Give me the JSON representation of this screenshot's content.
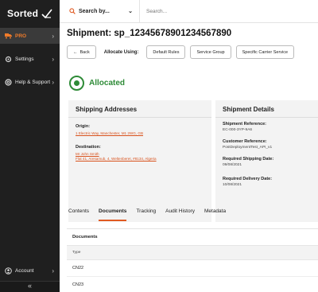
{
  "sidebar": {
    "brand": "Sorted",
    "items": [
      {
        "label": "PRO"
      },
      {
        "label": "Settings"
      },
      {
        "label": "Help & Support"
      }
    ],
    "account_label": "Account",
    "collapse_glyph": "«",
    "accent": "#f07b2a"
  },
  "topbar": {
    "search_scope": "Search by...",
    "search_placeholder": "Search..."
  },
  "page": {
    "title": "Shipment: sp_12345678901234567890",
    "back_label": "Back",
    "allocate_label": "Allocate Using:",
    "allocate_buttons": [
      "Default Rules",
      "Service Group",
      "Specific Carrier Service"
    ],
    "status": "Allocated",
    "status_color": "#2e8b37"
  },
  "addresses": {
    "title": "Shipping Addresses",
    "origin_label": "Origin:",
    "origin_value": "1 Electric Way, Manchester, M1 2WG, GB",
    "destination_label": "Destination:",
    "destination_name": "Mr John Smith",
    "destination_value": "Flat 41, Aresamub, 4, Weltenberet, #8134, Algeria"
  },
  "shipment_details": {
    "title": "Shipment Details",
    "fields": [
      {
        "label": "Shipment Reference:",
        "value": "EC-000-3YP-9A6"
      },
      {
        "label": "Customer Reference:",
        "value": "PostDeploymentTest_API_v1"
      },
      {
        "label": "Required Shipping Date:",
        "value": "09/08/2021"
      },
      {
        "label": "Required Delivery Date:",
        "value": "10/08/2021"
      }
    ]
  },
  "tabs": [
    "Contents",
    "Documents",
    "Tracking",
    "Audit History",
    "Metadata"
  ],
  "active_tab": "Documents",
  "documents": {
    "title": "Documents",
    "column_header": "Type",
    "rows": [
      "CN22",
      "CN23"
    ]
  }
}
